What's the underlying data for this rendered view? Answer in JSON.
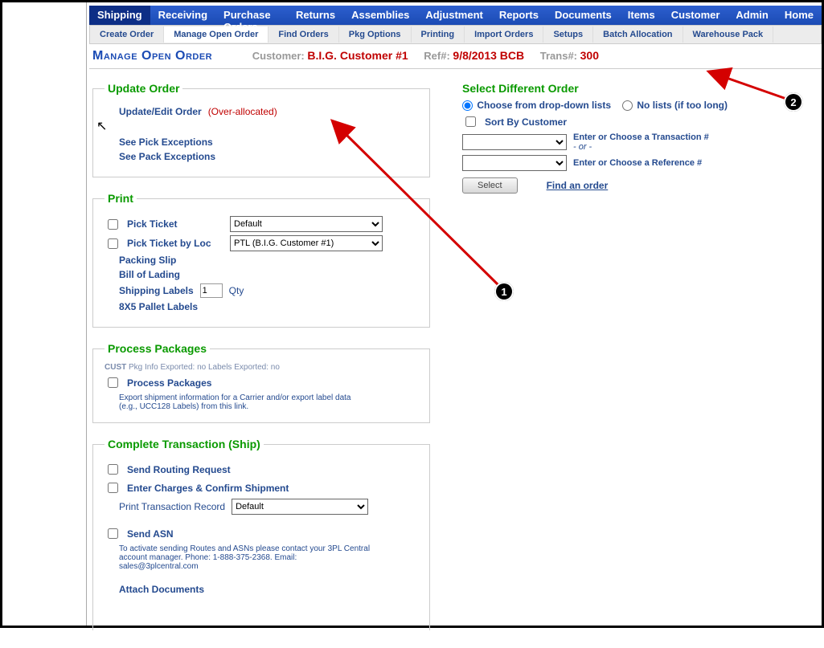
{
  "nav": {
    "main": [
      "Shipping",
      "Receiving",
      "Purchase Orders",
      "Returns",
      "Assemblies",
      "Adjustment",
      "Reports",
      "Documents",
      "Items",
      "Customer",
      "Admin",
      "Home"
    ],
    "main_active": 0,
    "sub": [
      "Create Order",
      "Manage Open Order",
      "Find Orders",
      "Pkg Options",
      "Printing",
      "Import Orders",
      "Setups",
      "Batch Allocation",
      "Warehouse Pack"
    ],
    "sub_active": 1
  },
  "header": {
    "page_title": "Manage Open Order",
    "labels": {
      "customer": "Customer:",
      "ref": "Ref#:",
      "trans": "Trans#:"
    },
    "customer": "B.I.G. Customer #1",
    "ref": "9/8/2013 BCB",
    "trans": "300"
  },
  "update_order": {
    "legend": "Update Order",
    "links": {
      "update_edit": "Update/Edit Order",
      "over_alloc": "(Over-allocated)",
      "see_pick": "See Pick Exceptions",
      "see_pack": "See Pack Exceptions"
    }
  },
  "print": {
    "legend": "Print",
    "pick_ticket": "Pick Ticket",
    "pick_ticket_select": "Default",
    "pick_ticket_loc": "Pick Ticket by Loc",
    "pick_ticket_loc_select": "PTL (B.I.G. Customer #1)",
    "packing_slip": "Packing Slip",
    "bill_of_lading": "Bill of Lading",
    "shipping_labels": "Shipping Labels",
    "shipping_labels_qty": "1",
    "qty_label": "Qty",
    "pallet_labels": "8X5 Pallet Labels"
  },
  "process_pkg": {
    "legend": "Process Packages",
    "status_prefix": "CUST",
    "status": "Pkg Info Exported: no Labels Exported: no",
    "link": "Process Packages",
    "desc": "Export shipment information for a Carrier and/or export label data (e.g., UCC128 Labels) from this link."
  },
  "complete": {
    "legend": "Complete Transaction (Ship)",
    "send_routing": "Send Routing Request",
    "enter_charges": "Enter Charges & Confirm Shipment",
    "print_record": "Print Transaction Record",
    "print_record_select": "Default",
    "send_asn": "Send ASN",
    "send_asn_desc": "To activate sending Routes and ASNs please contact your 3PL Central account manager. Phone: 1-888-375-2368. Email: sales@3plcentral.com",
    "attach_docs": "Attach Documents"
  },
  "select_order": {
    "legend": "Select Different Order",
    "opt_dropdown": "Choose from drop-down lists",
    "opt_nolist": "No lists (if too long)",
    "sort_by_customer": "Sort By Customer",
    "hint_trans": "Enter or Choose a Transaction #",
    "hint_or": " - or - ",
    "hint_ref": "Enter or Choose a Reference #",
    "select_btn": "Select",
    "find_link": "Find an order"
  },
  "annotations": {
    "c1": "1",
    "c2": "2"
  }
}
